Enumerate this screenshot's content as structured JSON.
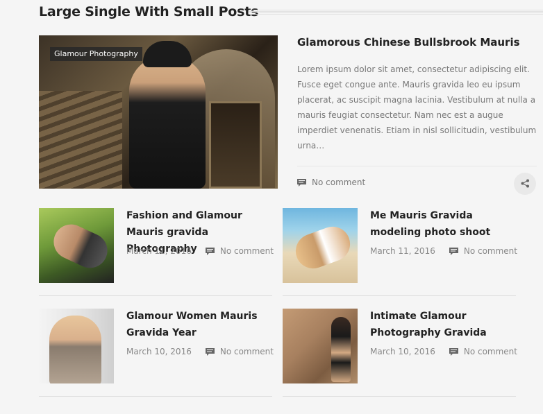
{
  "section": {
    "title": "Large Single With Small Posts"
  },
  "featured": {
    "category": "Glamour Photography",
    "title": "Glamorous Chinese Bullsbrook Mauris",
    "excerpt": "Lorem ipsum dolor sit amet, consectetur adipiscing elit. Fusce eget congue ante. Mauris gravida leo eu ipsum placerat, ac suscipit magna lacinia. Vestibulum at nulla a mauris feugiat consectetur. Nam nec est a augue imperdiet venenatis. Etiam in nisl sollicitudin, vestibulum urna…",
    "comments": "No comment",
    "icons": {
      "comment": "comment-icon",
      "share": "share-icon"
    }
  },
  "posts": [
    {
      "title": "Fashion and Glamour Mauris gravida Photography",
      "date": "March 11, 2016",
      "comments": "No comment"
    },
    {
      "title": "Me Mauris Gravida modeling photo shoot",
      "date": "March 11, 2016",
      "comments": "No comment"
    },
    {
      "title": "Glamour Women Mauris Gravida Year",
      "date": "March 10, 2016",
      "comments": "No comment"
    },
    {
      "title": "Intimate Glamour Photography Gravida",
      "date": "March 10, 2016",
      "comments": "No comment"
    }
  ],
  "colors": {
    "background": "#f5f5f5",
    "heading": "#222222",
    "muted": "#777777",
    "badge_bg": "#282828"
  }
}
